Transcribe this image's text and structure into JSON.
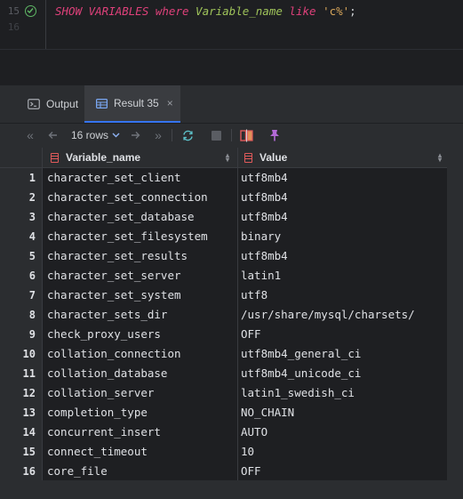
{
  "editor": {
    "line_number": "15",
    "line_number_next": "16",
    "code": {
      "kw1": "SHOW VARIABLES where",
      "ident": "Variable_name",
      "kw2": "like",
      "str": "'c%'",
      "end": ";"
    }
  },
  "tabs": {
    "output_label": "Output",
    "result_label": "Result 35",
    "close_glyph": "×"
  },
  "toolbar": {
    "rows_label": "16 rows",
    "first_glyph": "«",
    "prev_glyph": "⏴",
    "next_glyph": "⏵",
    "last_glyph": "»",
    "chevron": "⌄"
  },
  "grid": {
    "columns": [
      "Variable_name",
      "Value"
    ],
    "rows": [
      {
        "n": "1",
        "name": "character_set_client",
        "value": "utf8mb4"
      },
      {
        "n": "2",
        "name": "character_set_connection",
        "value": "utf8mb4"
      },
      {
        "n": "3",
        "name": "character_set_database",
        "value": "utf8mb4"
      },
      {
        "n": "4",
        "name": "character_set_filesystem",
        "value": "binary"
      },
      {
        "n": "5",
        "name": "character_set_results",
        "value": "utf8mb4"
      },
      {
        "n": "6",
        "name": "character_set_server",
        "value": "latin1"
      },
      {
        "n": "7",
        "name": "character_set_system",
        "value": "utf8"
      },
      {
        "n": "8",
        "name": "character_sets_dir",
        "value": "/usr/share/mysql/charsets/"
      },
      {
        "n": "9",
        "name": "check_proxy_users",
        "value": "OFF"
      },
      {
        "n": "10",
        "name": "collation_connection",
        "value": "utf8mb4_general_ci"
      },
      {
        "n": "11",
        "name": "collation_database",
        "value": "utf8mb4_unicode_ci"
      },
      {
        "n": "12",
        "name": "collation_server",
        "value": "latin1_swedish_ci"
      },
      {
        "n": "13",
        "name": "completion_type",
        "value": "NO_CHAIN"
      },
      {
        "n": "14",
        "name": "concurrent_insert",
        "value": "AUTO"
      },
      {
        "n": "15",
        "name": "connect_timeout",
        "value": "10"
      },
      {
        "n": "16",
        "name": "core_file",
        "value": "OFF"
      }
    ]
  },
  "colors": {
    "keyword": "#e0417b",
    "identifier": "#9fc35a",
    "string": "#d7a55a",
    "accent": "#3574f0",
    "table_icon": "#e05a5a",
    "success": "#5fb865"
  }
}
